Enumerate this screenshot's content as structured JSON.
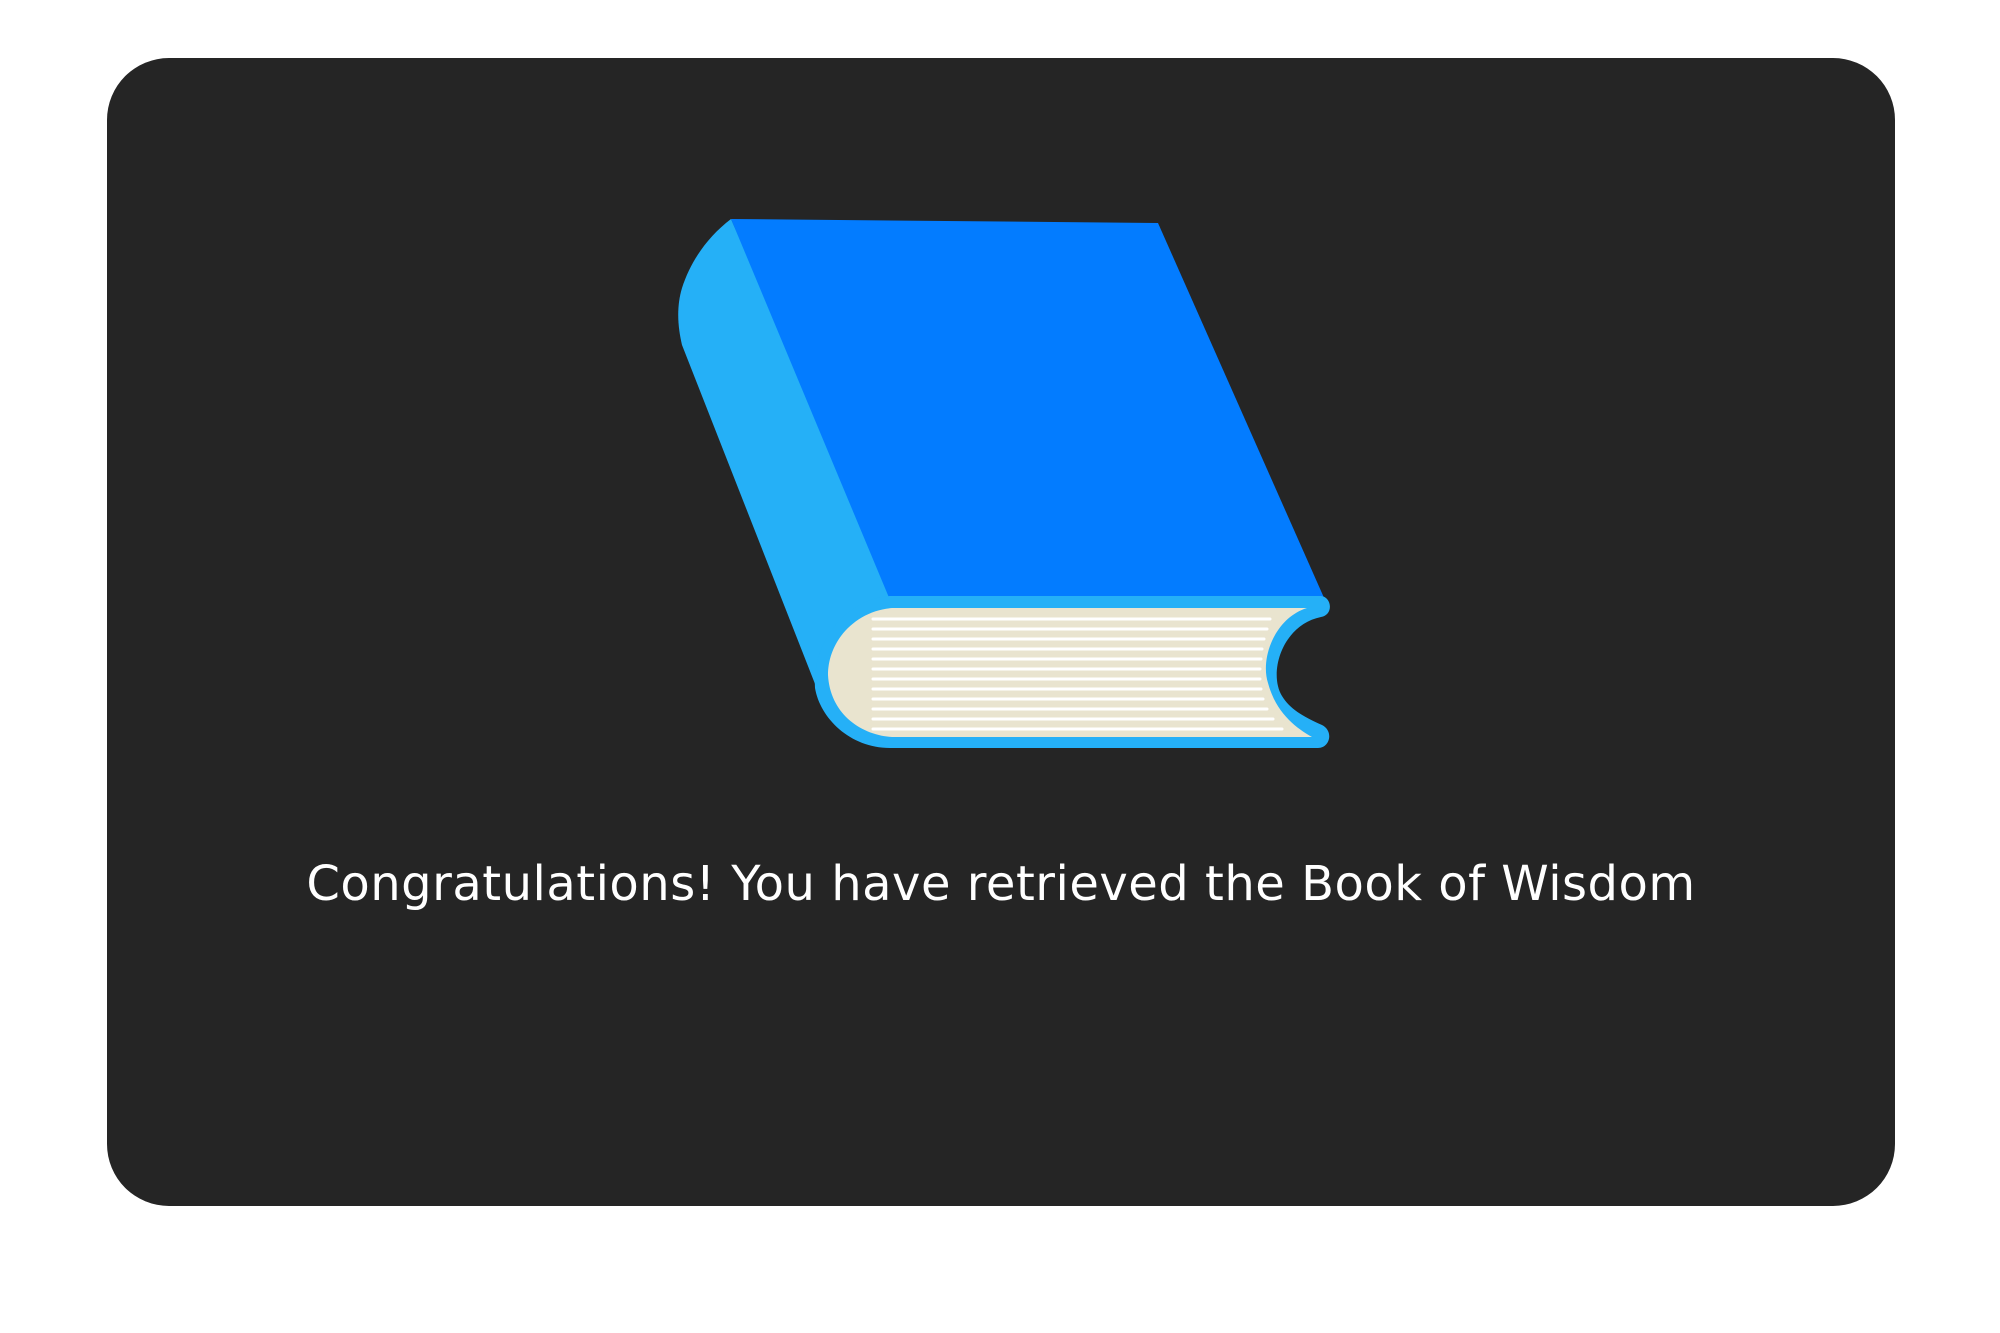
{
  "message": "Congratulations! You have retrieved the Book of Wisdom",
  "icons": {
    "main": "book-icon"
  },
  "colors": {
    "page_background": "#ffffff",
    "card_background": "#252525",
    "book_cover": "#037cff",
    "book_spine": "#25b0f7",
    "book_pages": "#e9e4cf",
    "page_lines": "#ffffff",
    "text": "#ffffff"
  }
}
